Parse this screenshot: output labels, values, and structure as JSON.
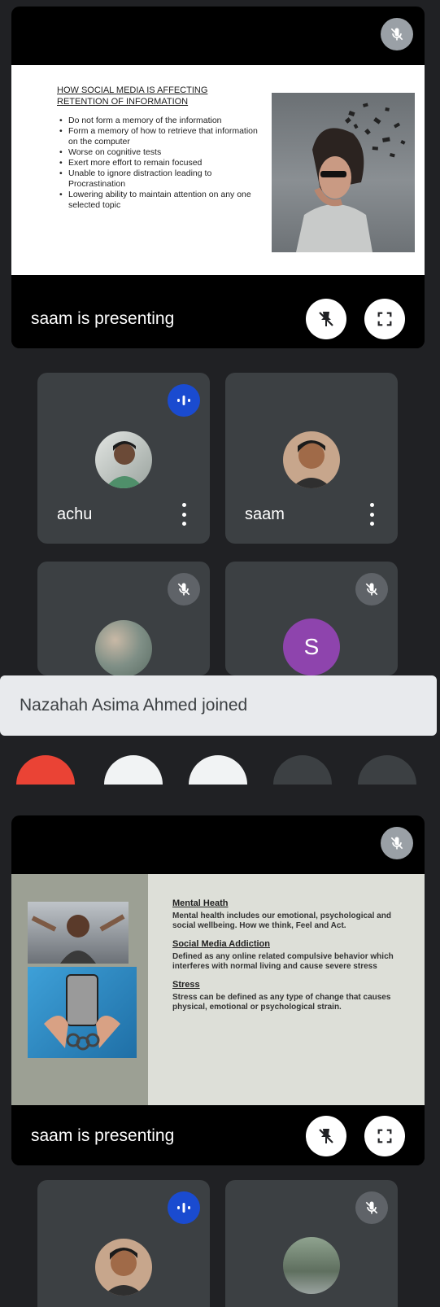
{
  "presentation_top": {
    "slide_title_line1": "HOW SOCIAL MEDIA IS AFFECTING",
    "slide_title_line2": "RETENTION OF INFORMATION",
    "bullets": [
      "Do not form a memory of the information",
      "Form a memory of how to retrieve that information on the computer",
      "Worse on cognitive tests",
      "Exert more effort to remain focused",
      "Unable to ignore distraction leading to Procrastination",
      "Lowering ability to maintain attention on any one selected topic"
    ],
    "presenting_label": "saam is presenting"
  },
  "participants_top": [
    {
      "name": "achu"
    },
    {
      "name": "saam"
    }
  ],
  "participants_mid": [
    {
      "initial": "S"
    }
  ],
  "toast": {
    "message": "Nazahah Asima Ahmed joined"
  },
  "presentation_bottom": {
    "sections": [
      {
        "heading": "Mental Heath",
        "body": "Mental health includes our emotional, psychological and social wellbeing. How we think, Feel and Act."
      },
      {
        "heading": "Social Media Addiction",
        "body": "Defined as any online related compulsive behavior which interferes with normal living and cause severe stress"
      },
      {
        "heading": "Stress",
        "body": "Stress can be defined as any type of change that causes physical, emotional or psychological strain."
      }
    ],
    "presenting_label": "saam is presenting"
  },
  "colors": {
    "background": "#202124",
    "tile": "#3c4043",
    "speaking_badge": "#1a4bd0",
    "end_call": "#ea4335",
    "avatar_s": "#8e44ad"
  }
}
